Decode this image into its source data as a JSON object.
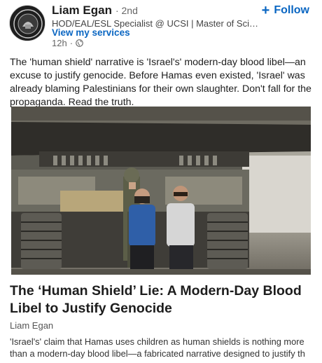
{
  "post": {
    "author": {
      "name": "Liam Egan",
      "degree": "· 2nd",
      "headline": "HOD/EAL/ESL Specialist @ UCSI | Master of Scien...",
      "services_link": "View my services",
      "time": "12h",
      "visibility_icon": "globe-icon"
    },
    "follow_label": "Follow",
    "follow_icon": "plus-icon",
    "text": "The 'human shield' narrative is 'Israel's' modern-day blood libel—an excuse to justify genocide. Before Hamas even existed, 'Israel' was already blaming Palestinians for their own slaughter. Don't fall for the propaganda. Read the truth."
  },
  "article": {
    "image_alt": "Soldier beside tank with two detained men in front of an armored vehicle",
    "title": "The ‘Human Shield’ Lie: A Modern-Day Blood Libel to Justify Genocide",
    "author": "Liam Egan",
    "excerpt_line1": "'Israel's' claim that Hamas uses children as human shields is nothing more",
    "excerpt_line2": "than a modern-day blood libel—a fabricated narrative designed to justify th"
  },
  "colors": {
    "link_blue": "#0a66c2",
    "text_primary": "#1d1d1d",
    "text_secondary": "#666666"
  }
}
